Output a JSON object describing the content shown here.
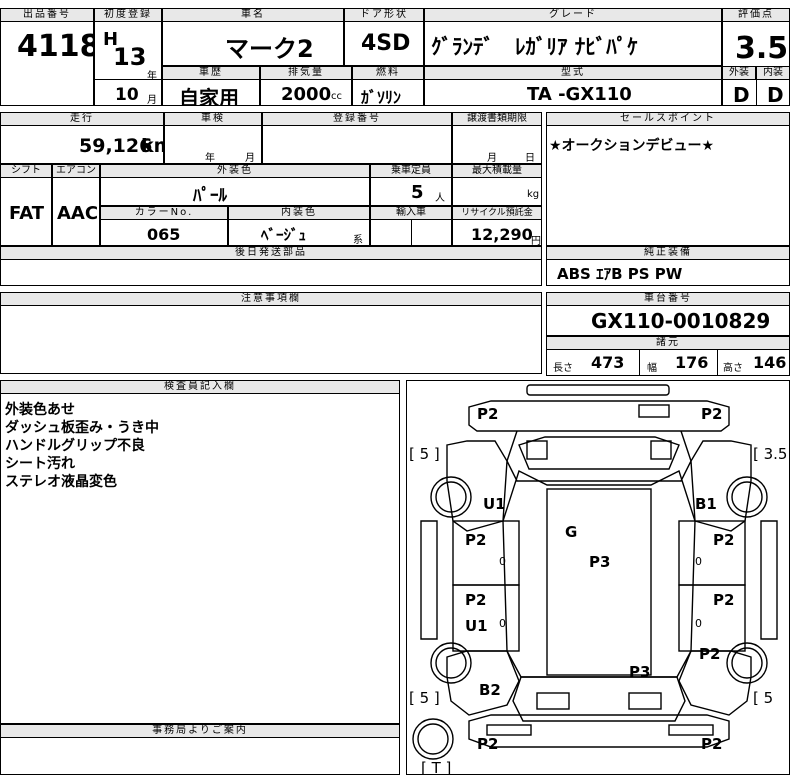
{
  "header": {
    "lot_label": "出品番号",
    "lot_number": "4118",
    "first_reg_label": "初度登録",
    "era": "H",
    "year": "13",
    "year_unit": "年",
    "month": "10",
    "month_unit": "月",
    "car_name_label": "車名",
    "car_name": "マーク2",
    "door_label": "ドア形状",
    "door": "4SD",
    "grade_label": "グレード",
    "grade": "ｸﾞﾗﾝﾃﾞ　ﾚｶﾞﾘｱ ﾅﾋﾞﾊﾟｹ",
    "score_label": "評価点",
    "score": "3.5",
    "history_label": "車歴",
    "history": "自家用",
    "displacement_label": "排気量",
    "displacement": "2000",
    "displacement_unit": "cc",
    "fuel_label": "燃料",
    "fuel": "ｶﾞｿﾘﾝ",
    "model_label": "型式",
    "model": "TA -GX110",
    "exterior_label": "外装",
    "exterior_grade": "D",
    "interior_label": "内装",
    "interior_grade": "D"
  },
  "row2": {
    "mileage_label": "走行",
    "mileage": "59,126",
    "mileage_unit": "km",
    "inspection_label": "車検",
    "inspection_year_unit": "年",
    "inspection_month_unit": "月",
    "reg_number_label": "登録番号",
    "transfer_label": "譲渡書類期限",
    "transfer_month_unit": "月",
    "transfer_day_unit": "日",
    "sales_label": "セールスポイント",
    "sales_text": "★オークションデビュー★"
  },
  "row3": {
    "shift_label": "シフト",
    "shift": "FAT",
    "aircon_label": "エアコン",
    "aircon": "AAC",
    "ext_color_label": "外装色",
    "ext_color": "ﾊﾟｰﾙ",
    "capacity_label": "乗車定員",
    "capacity": "5",
    "capacity_unit": "人",
    "load_label": "最大積載量",
    "load_unit": "kg",
    "color_no_label": "カラーNo.",
    "color_no": "065",
    "int_color_label": "内装色",
    "int_color": "ﾍﾞｰｼﾞｭ",
    "int_color_unit": "系",
    "import_label": "輸入車",
    "recycle_label": "リサイクル預託金",
    "recycle": "12,290",
    "recycle_unit": "円"
  },
  "parts": {
    "later_parts_label": "後日発送部品",
    "genuine_label": "純正装備",
    "genuine": "ABS ｴｱB PS PW"
  },
  "notes": {
    "caution_label": "注意事項欄",
    "chassis_label": "車台番号",
    "chassis": "GX110-0010829",
    "specs_label": "諸元",
    "length_label": "長さ",
    "length": "473",
    "width_label": "幅",
    "width": "176",
    "height_label": "高さ",
    "height": "146"
  },
  "inspector": {
    "label": "検査員記入欄",
    "lines": [
      "外装色あせ",
      "ダッシュ板歪み・うき中",
      "ハンドルグリップ不良",
      "シート汚れ",
      "ステレオ液晶変色"
    ],
    "office_label": "事務局よりご案内"
  },
  "diagram": {
    "marks": {
      "front_left": "P2",
      "front_right": "P2",
      "bracket_fl": "[ 5 ]",
      "bracket_fr": "[ 3.5",
      "u1_front": "U1",
      "b1": "B1",
      "g": "G",
      "door_fl": "P2",
      "door_fr": "P2",
      "p3_roof": "P3",
      "door_rl": "P2",
      "door_rr": "P2",
      "u1_rear": "U1",
      "p2_rear_right": "P2",
      "p3_trunk": "P3",
      "b2": "B2",
      "bracket_rl": "[ 5 ]",
      "bracket_rr": "[ 5",
      "rear_left": "P2",
      "rear_right": "P2",
      "bracket_t": "[ T ]",
      "z1": "0",
      "z2": "0",
      "z3": "0",
      "z4": "0"
    }
  }
}
